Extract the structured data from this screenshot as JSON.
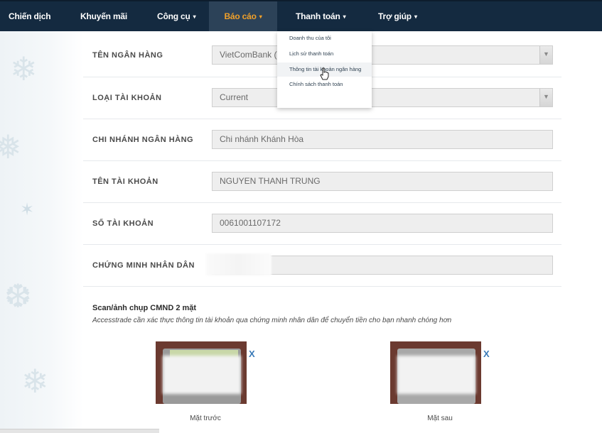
{
  "nav": {
    "items": [
      {
        "label": "Chiến dịch",
        "caret": false
      },
      {
        "label": "Khuyến mãi",
        "caret": false
      },
      {
        "label": "Công cụ",
        "caret": true
      },
      {
        "label": "Báo cáo",
        "caret": true
      },
      {
        "label": "Thanh toán",
        "caret": true
      },
      {
        "label": "Trợ giúp",
        "caret": true
      }
    ],
    "active": "Báo cáo",
    "accent_color": "#f0a02a",
    "bar_color": "#142a40",
    "caret_icon": "▾"
  },
  "dropdown": {
    "items": [
      "Doanh thu của tôi",
      "Lịch sử thanh toán",
      "Thông tin tài khoản ngân hàng",
      "Chính sách thanh toán"
    ],
    "hovered": "Thông tin tài khoản ngân hàng"
  },
  "form": {
    "rows": [
      {
        "label": "TÊN NGÂN HÀNG",
        "value": "VietComBank (V",
        "type": "select"
      },
      {
        "label": "LOẠI TÀI KHOẢN",
        "value": "Current",
        "type": "select"
      },
      {
        "label": "CHI NHÁNH NGÂN HÀNG",
        "value": "Chi nhánh Khánh Hòa",
        "type": "text"
      },
      {
        "label": "TÊN TÀI KHOẢN",
        "value": "NGUYEN THANH TRUNG",
        "type": "text"
      },
      {
        "label": "SỐ TÀI KHOẢN",
        "value": "0061001107172",
        "type": "text"
      },
      {
        "label": "CHỨNG MINH NHÂN DÂN",
        "value": "",
        "type": "text"
      }
    ],
    "select_arrow_icon": "chevron-down-icon"
  },
  "scan": {
    "title": "Scan/ảnh chụp CMND 2 mặt",
    "description": "Accesstrade cần xác thực thông tin tài khoản qua chứng minh nhân dân để chuyển tiền cho bạn nhanh chóng hơn",
    "front": {
      "caption": "Mặt trước",
      "delete_label": "X"
    },
    "back": {
      "caption": "Mặt sau",
      "delete_label": "X"
    }
  }
}
